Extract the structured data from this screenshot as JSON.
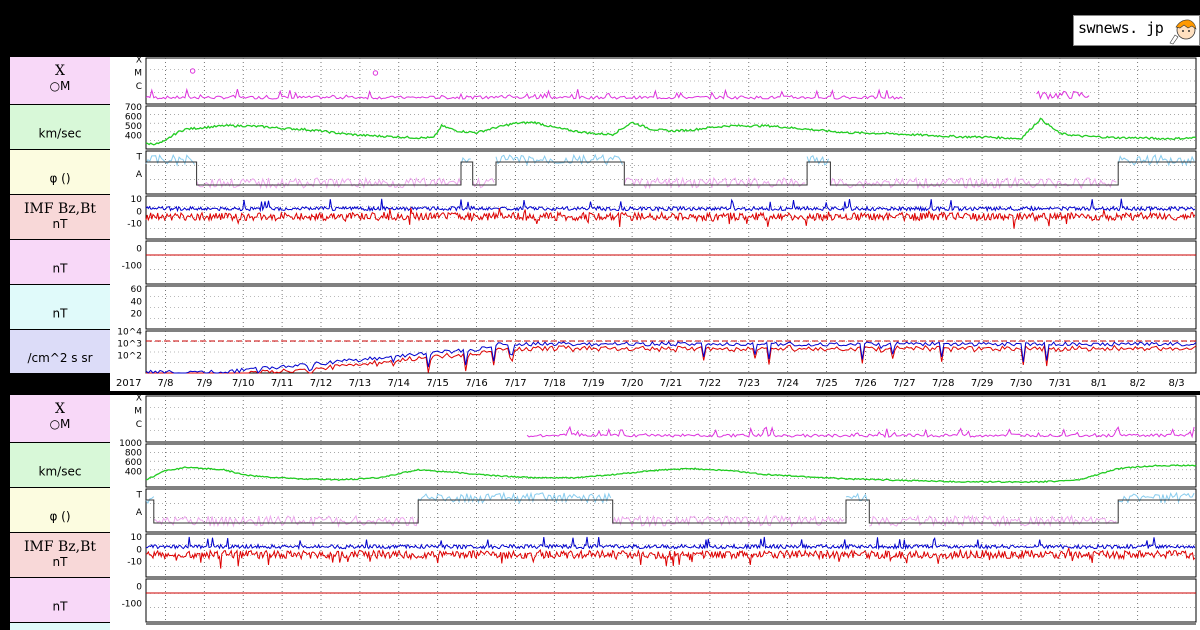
{
  "logo": {
    "text": "swnews. jp"
  },
  "colors": {
    "xray": "#dd33dd",
    "wind": "#22cc22",
    "phi_toward": "#88ccee",
    "phi_away": "#eeaaee",
    "bt": "#0000cc",
    "bz": "#dd0000",
    "zero_line": "#cc0000",
    "proton_high": "#0000cc",
    "proton_low": "#dd0000",
    "label_pink": "#f8d8f8",
    "label_green": "#d8f8d8",
    "label_yellow": "#fcfce0",
    "label_rose": "#f8d8d8",
    "label_cyan": "#e0fafa",
    "label_lavender": "#dcdcf8"
  },
  "panels": [
    {
      "labels": [
        {
          "l1": "X",
          "l2": "○M"
        },
        {
          "l1": "",
          "l2": "km/sec"
        },
        {
          "l1": "",
          "l2": "φ ()"
        },
        {
          "l1": "IMF Bz,Bt",
          "l2": "nT"
        },
        {
          "l1": "",
          "l2": "nT"
        },
        {
          "l1": "",
          "l2": "nT"
        },
        {
          "l1": "",
          "l2": "/cm^2 s sr"
        }
      ],
      "year": "2017",
      "dates": [
        "7/8",
        "7/9",
        "7/10",
        "7/11",
        "7/12",
        "7/13",
        "7/14",
        "7/15",
        "7/16",
        "7/17",
        "7/18",
        "7/19",
        "7/20",
        "7/21",
        "7/22",
        "7/23",
        "7/24",
        "7/25",
        "7/26",
        "7/27",
        "7/28",
        "7/29",
        "7/30",
        "7/31",
        "8/1",
        "8/2",
        "8/3"
      ]
    },
    {
      "labels": [
        {
          "l1": "X",
          "l2": "○M"
        },
        {
          "l1": "",
          "l2": "km/sec"
        },
        {
          "l1": "",
          "l2": "φ ()"
        },
        {
          "l1": "IMF Bz,Bt",
          "l2": "nT"
        },
        {
          "l1": "",
          "l2": "nT"
        }
      ]
    }
  ],
  "chart_data": [
    {
      "type": "line",
      "title": "",
      "xlabel": "",
      "year": "2017",
      "categories": [
        "7/8",
        "7/9",
        "7/10",
        "7/11",
        "7/12",
        "7/13",
        "7/14",
        "7/15",
        "7/16",
        "7/17",
        "7/18",
        "7/19",
        "7/20",
        "7/21",
        "7/22",
        "7/23",
        "7/24",
        "7/25",
        "7/26",
        "7/27",
        "7/28",
        "7/29",
        "7/30",
        "7/31",
        "8/1",
        "8/2",
        "8/3"
      ],
      "subplots": [
        {
          "name": "xray",
          "y_ticks": [
            "X",
            "M",
            "C"
          ],
          "flare_markers_day": [
            0.3,
            6.0
          ],
          "series": [
            {
              "values": [
                0.35,
                0.55,
                0.4,
                0.3,
                0.3,
                0.35,
                0.75,
                0.4,
                0.3,
                0.3,
                0.32,
                0.3,
                0.3,
                0.32,
                0.28,
                0.25,
                0.15,
                0.05,
                0.0,
                0.0,
                0.0,
                0.0,
                0.0,
                0.0,
                0.0,
                0.0,
                0.0,
                0.0,
                0.0,
                0.0,
                0.0,
                0.0,
                0.0,
                0.0,
                0.0,
                0.0,
                0.0,
                0.0,
                0.0,
                0.0,
                0.0,
                0.0,
                0.0,
                0.0,
                0.0,
                0.0,
                0.0,
                0.0,
                0.0,
                0.0,
                0.0,
                0.0,
                0.0,
                0.0,
                0.0,
                0.0,
                0.0,
                0.0,
                0.0,
                0.0,
                0.0,
                0.0,
                0.0,
                0.0,
                0.0,
                0.0,
                0.0,
                0.0,
                0.0,
                0.0,
                0.0,
                0.0,
                0.0,
                0.0,
                0.0,
                0.0,
                0.0,
                0.0,
                0.0,
                0.0,
                0.35,
                0.4,
                0.38,
                0.3,
                0.0,
                0.0,
                0.0,
                0.2,
                0.0
              ]
            }
          ]
        },
        {
          "name": "wind_speed",
          "unit": "km/sec",
          "y_ticks": [
            700,
            600,
            500,
            400
          ],
          "ylim": [
            300,
            780
          ],
          "series": [
            {
              "x": [
                0,
                0.3,
                0.5,
                0.6,
                0.8,
                1.0,
                1.5,
                2.0,
                2.5,
                3.0,
                3.5,
                4.0,
                4.5,
                5.0,
                5.5,
                6.0,
                6.5,
                7.0,
                7.4,
                7.6,
                8.0,
                8.5,
                9.0,
                9.5,
                10.0,
                10.5,
                11.0,
                11.5,
                12.0,
                12.5,
                13.0,
                13.5,
                14.0,
                14.5,
                15.0,
                15.5,
                16.0,
                16.5,
                17.0,
                17.5,
                18.0,
                19.0,
                20.0,
                21.0,
                21.5,
                22.0,
                22.5,
                23.0,
                23.5,
                24.0,
                24.5,
                25.0,
                25.5,
                26.0,
                26.5,
                27.0
              ],
              "values": [
                350,
                350,
                380,
                420,
                480,
                520,
                540,
                560,
                560,
                550,
                530,
                520,
                500,
                470,
                450,
                440,
                430,
                420,
                420,
                560,
                500,
                480,
                540,
                590,
                600,
                540,
                500,
                470,
                460,
                600,
                520,
                500,
                510,
                540,
                560,
                560,
                560,
                540,
                520,
                500,
                480,
                470,
                450,
                430,
                430,
                420,
                410,
                640,
                470,
                440,
                430,
                420,
                420,
                410,
                410,
                420
              ]
            }
          ]
        },
        {
          "name": "phi",
          "y_ticks": [
            "T",
            "A"
          ]
        },
        {
          "name": "imf",
          "unit": "nT",
          "y_ticks": [
            10,
            0,
            -10
          ],
          "ylim": [
            -25,
            25
          ]
        },
        {
          "name": "nT_a",
          "unit": "nT",
          "y_ticks": [
            0,
            -100
          ],
          "ylim": [
            -200,
            50
          ]
        },
        {
          "name": "nT_b",
          "unit": "nT",
          "y_ticks": [
            60,
            40,
            20
          ],
          "ylim": [
            0,
            80
          ]
        },
        {
          "name": "electron_flux",
          "unit": "/cm^2 s sr",
          "y_ticks": [
            "10^4",
            "10^3",
            "10^2"
          ],
          "log": true
        }
      ]
    },
    {
      "type": "line",
      "subplots": [
        {
          "name": "xray",
          "y_ticks": [
            "X",
            "M",
            "C"
          ]
        },
        {
          "name": "wind_speed",
          "unit": "km/sec",
          "y_ticks": [
            1000,
            800,
            600,
            400
          ],
          "ylim": [
            300,
            1100
          ],
          "series": [
            {
              "x": [
                0,
                0.5,
                1,
                1.5,
                2,
                2.5,
                3,
                4,
                5,
                6,
                7,
                8,
                9,
                10,
                11,
                12,
                13,
                14,
                15,
                16,
                17,
                18,
                19,
                20,
                21,
                22,
                23,
                24,
                25,
                26,
                27
              ],
              "values": [
                420,
                600,
                660,
                640,
                620,
                520,
                480,
                440,
                420,
                460,
                620,
                560,
                500,
                460,
                460,
                520,
                600,
                640,
                600,
                520,
                480,
                440,
                420,
                400,
                380,
                380,
                380,
                420,
                640,
                700,
                700
              ]
            }
          ]
        },
        {
          "name": "phi",
          "y_ticks": [
            "T",
            "A"
          ]
        },
        {
          "name": "imf",
          "unit": "nT",
          "y_ticks": [
            10,
            0,
            -10
          ],
          "ylim": [
            -25,
            25
          ]
        },
        {
          "name": "nT_a",
          "unit": "nT",
          "y_ticks": [
            0,
            -100
          ],
          "ylim": [
            -200,
            50
          ]
        }
      ]
    }
  ]
}
